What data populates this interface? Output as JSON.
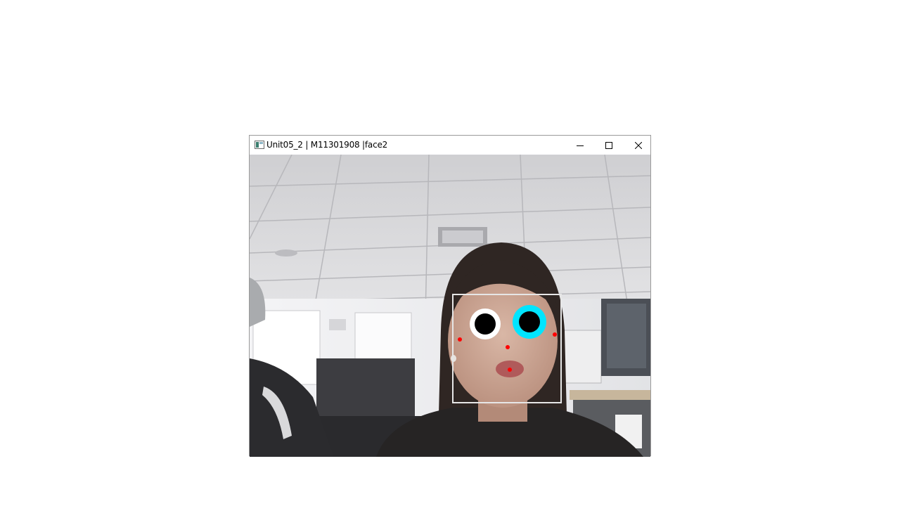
{
  "window": {
    "title": "Unit05_2 | M11301908 |face2",
    "icon": "app-window-icon",
    "controls": [
      "minimize-icon",
      "maximize-icon",
      "close-icon"
    ]
  },
  "overlay": {
    "face_box_color": "#e6e6e6",
    "left_eye_ring_color": "#ffffff",
    "right_eye_ring_color": "#00e5ff",
    "pupil_color": "#000000",
    "landmark_color": "#ff0000"
  }
}
